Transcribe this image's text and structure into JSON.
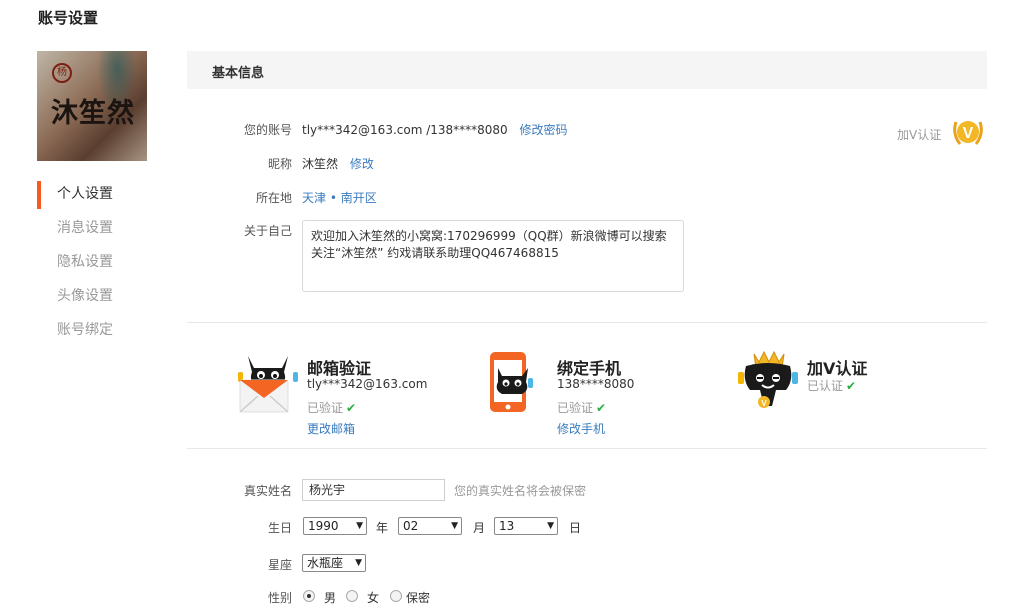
{
  "page": {
    "title": "账号设置"
  },
  "avatar": {
    "seal_text": "杨",
    "calligraphy": "沐笙然"
  },
  "sidebar": {
    "items": [
      {
        "label": "个人设置"
      },
      {
        "label": "消息设置"
      },
      {
        "label": "隐私设置"
      },
      {
        "label": "头像设置"
      },
      {
        "label": "账号绑定"
      }
    ],
    "active_index": 0
  },
  "basic": {
    "section_title": "基本信息",
    "account": {
      "label": "您的账号",
      "value": "tly***342@163.com /138****8080",
      "action": "修改密码"
    },
    "nickname": {
      "label": "昵称",
      "value": "沐笙然",
      "action": "修改"
    },
    "location": {
      "label": "所在地",
      "value": "天津 • 南开区"
    },
    "about": {
      "label": "关于自己",
      "value": "欢迎加入沐笙然的小窝窝:170296999（QQ群）新浪微博可以搜索关注“沐笙然” 约戏请联系助理QQ467468815"
    },
    "vip": {
      "label": "加V认证",
      "badge": "V"
    }
  },
  "verifications": [
    {
      "title": "邮箱验证",
      "info": "tly***342@163.com",
      "status": "已验证",
      "action": "更改邮箱",
      "icon": "email-cat-icon"
    },
    {
      "title": "绑定手机",
      "info": "138****8080",
      "status": "已验证",
      "action": "修改手机",
      "icon": "phone-cat-icon"
    },
    {
      "title": "加V认证",
      "info": "",
      "status": "已认证",
      "action": "",
      "icon": "crown-cat-icon"
    }
  ],
  "profile": {
    "realname": {
      "label": "真实姓名",
      "value": "杨光宇",
      "hint": "您的真实姓名将会被保密"
    },
    "birthday": {
      "label": "生日",
      "year": "1990",
      "year_unit": "年",
      "month": "02",
      "month_unit": "月",
      "day": "13",
      "day_unit": "日"
    },
    "zodiac": {
      "label": "星座",
      "value": "水瓶座"
    },
    "gender": {
      "label": "性别",
      "options": [
        "男",
        "女",
        "保密"
      ],
      "selected": 0
    }
  },
  "colors": {
    "accent": "#f55a1f",
    "link": "#3a7bbf",
    "check": "#2bad3f",
    "vip_gold": "#e9a21c"
  }
}
